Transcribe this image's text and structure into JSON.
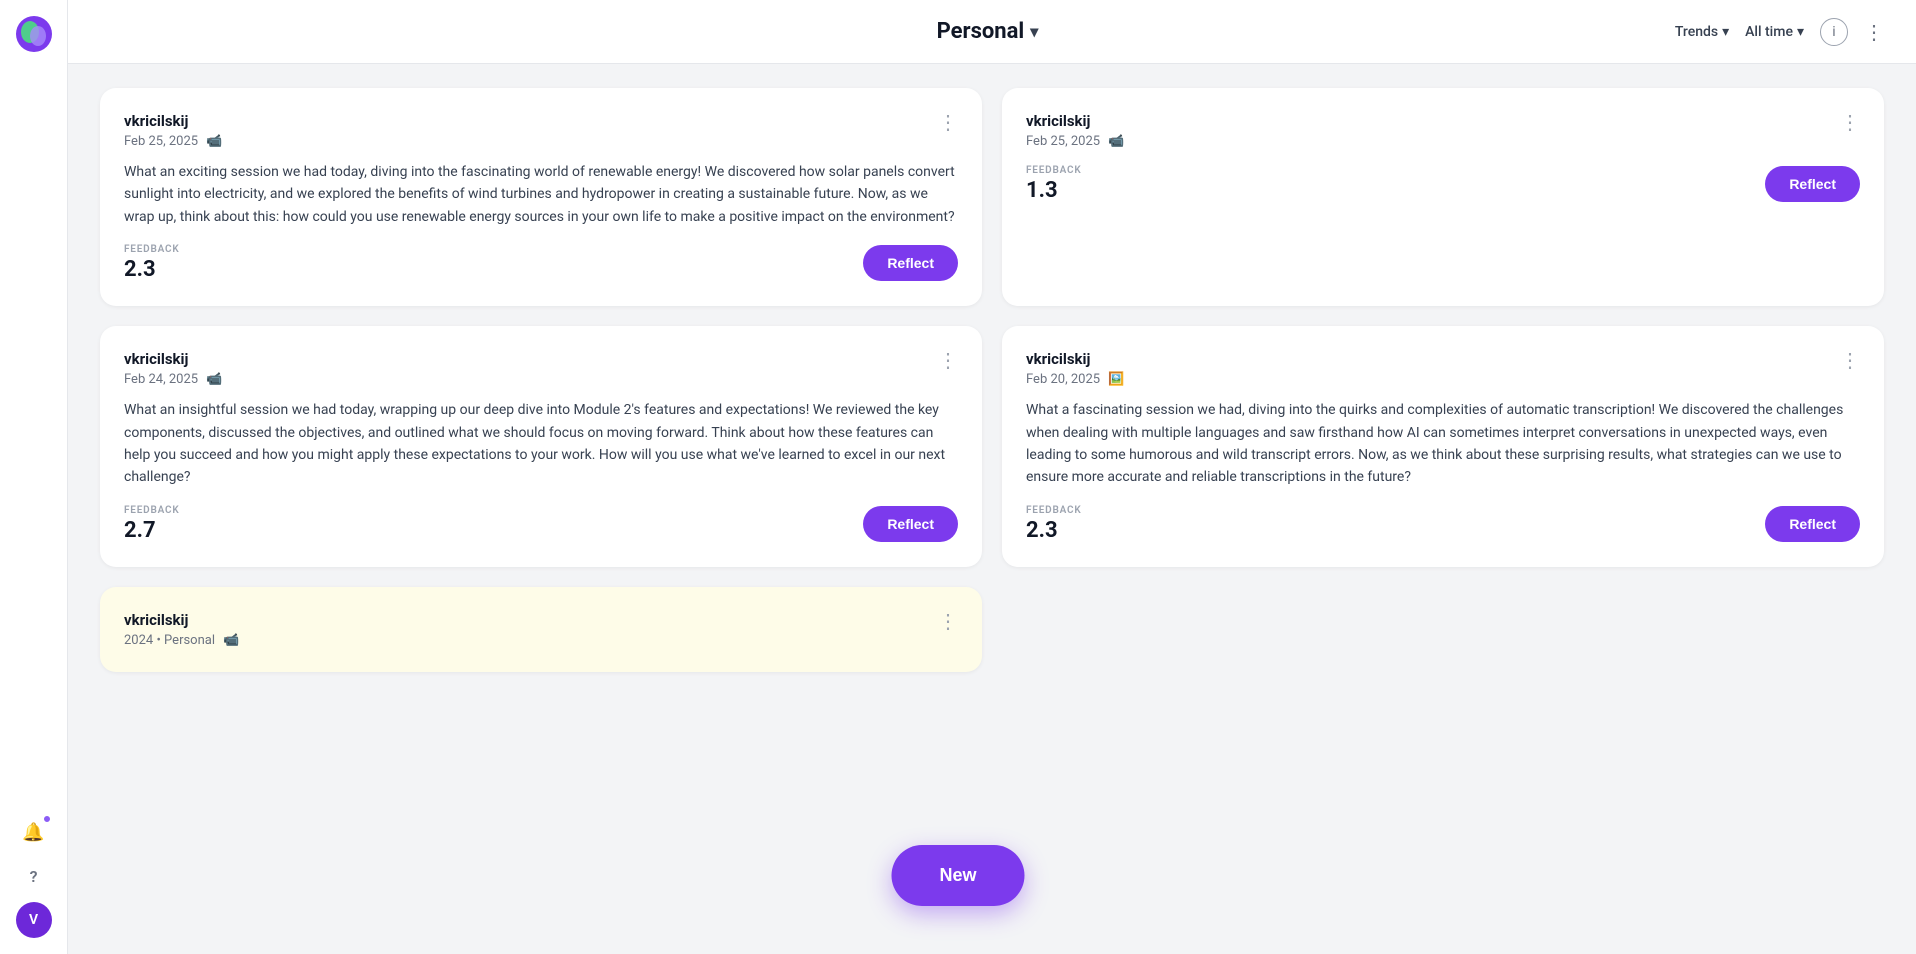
{
  "app": {
    "logo_initial": "🌐"
  },
  "sidebar": {
    "avatar_initial": "V",
    "notification_icon": "🔔",
    "help_icon": "?",
    "items": []
  },
  "header": {
    "title": "Personal",
    "chevron": "▾",
    "trends_label": "Trends",
    "alltime_label": "All time",
    "info_icon": "ⓘ",
    "more_icon": "⋮"
  },
  "new_button": {
    "label": "New"
  },
  "cards": [
    {
      "id": "card-1",
      "username": "vkricilskij",
      "date": "Feb 25, 2025",
      "icon_type": "video",
      "body": "What an exciting session we had today, diving into the fascinating world of renewable energy! We discovered how solar panels convert sunlight into electricity, and we explored the benefits of wind turbines and hydropower in creating a sustainable future. Now, as we wrap up, think about this: how could you use renewable energy sources in your own life to make a positive impact on the environment?",
      "feedback_label": "FEEDBACK",
      "feedback_value": "2.3",
      "has_reflect": true,
      "reflect_label": "Reflect",
      "column": 0
    },
    {
      "id": "card-2",
      "username": "vkricilskij",
      "date": "Feb 25, 2025",
      "icon_type": "video",
      "body": null,
      "feedback_label": "FEEDBACK",
      "feedback_value": "1.3",
      "has_reflect": true,
      "reflect_label": "Reflect",
      "column": 1
    },
    {
      "id": "card-3",
      "username": "vkricilskij",
      "date": "Feb 24, 2025",
      "icon_type": "video",
      "body": "What an insightful session we had today, wrapping up our deep dive into Module 2's features and expectations! We reviewed the key components, discussed the objectives, and outlined what we should focus on moving forward. Think about how these features can help you succeed and how you might apply these expectations to your work. How will you use what we've learned to excel in our next challenge?",
      "feedback_label": "FEEDBACK",
      "feedback_value": "2.7",
      "has_reflect": true,
      "reflect_label": "Reflect",
      "column": 0
    },
    {
      "id": "card-4",
      "username": "vkricilskij",
      "date": "Feb 20, 2025",
      "icon_type": "image",
      "body": "What a fascinating session we had, diving into the quirks and complexities of automatic transcription! We discovered the challenges when dealing with multiple languages and saw firsthand how AI can sometimes interpret conversations in unexpected ways, even leading to some humorous and wild transcript errors. Now, as we think about these surprising results, what strategies can we use to ensure more accurate and reliable transcriptions in the future?",
      "feedback_label": "FEEDBACK",
      "feedback_value": "2.3",
      "has_reflect": true,
      "reflect_label": "Reflect",
      "column": 1
    },
    {
      "id": "card-5",
      "username": "vkricilskij",
      "date": "2024 • Personal",
      "icon_type": "video",
      "body": null,
      "feedback_label": null,
      "feedback_value": null,
      "has_reflect": false,
      "reflect_label": null,
      "column": 0,
      "partial": true,
      "yellow": true
    }
  ]
}
